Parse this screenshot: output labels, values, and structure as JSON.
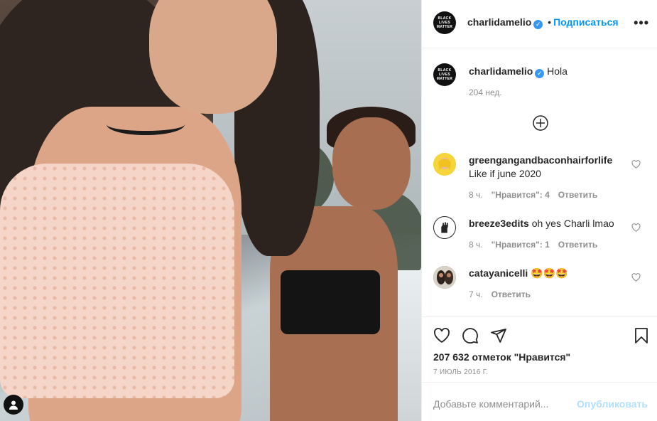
{
  "header": {
    "username": "charlidamelio",
    "avatar_text": "BLACK LIVES MATTER",
    "separator": "•",
    "follow_label": "Подписаться",
    "more_label": "•••"
  },
  "caption": {
    "username": "charlidamelio",
    "text": "Hola",
    "time": "204 нед."
  },
  "comments": [
    {
      "username": "greengangandbaconhairforlife",
      "text": "Like if june 2020",
      "time": "8 ч.",
      "likes": "\"Нравится\": 4",
      "reply": "Ответить"
    },
    {
      "username": "breeze3edits",
      "text": "oh yes Charli lmao",
      "time": "8 ч.",
      "likes": "\"Нравится\": 1",
      "reply": "Ответить"
    },
    {
      "username": "catayanicelli",
      "text": "🤩🤩🤩",
      "time": "7 ч.",
      "likes": "",
      "reply": "Ответить"
    }
  ],
  "stats": {
    "likes": "207 632 отметок \"Нравится\"",
    "date": "7 ИЮЛЬ 2016 Г."
  },
  "comment_box": {
    "placeholder": "Добавьте комментарий...",
    "post_label": "Опубликовать"
  },
  "icons": {
    "verified": "verified-badge-icon",
    "like": "heart-icon",
    "comment": "comment-icon",
    "share": "share-icon",
    "save": "bookmark-icon",
    "more_comments": "plus-circle-icon"
  },
  "colors": {
    "accent": "#0095f6",
    "muted": "#8e8e8e",
    "post_disabled": "#b2dffc",
    "verified": "#3897f0"
  }
}
